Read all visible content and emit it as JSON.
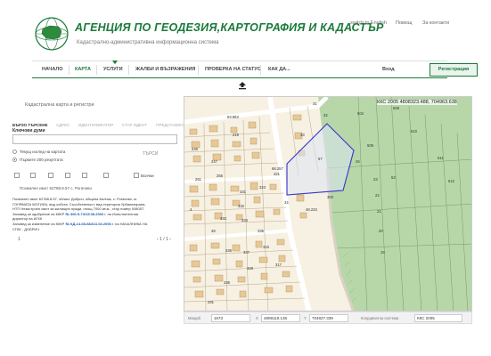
{
  "header": {
    "title": "АГЕНЦИЯ ПО ГЕОДЕЗИЯ,КАРТОГРАФИЯ И КАДАСТЪР",
    "subtitle": "Кадастрално-административна информационна система",
    "links": {
      "english": "switch to English",
      "help": "Помощ",
      "contacts": "За контакти"
    }
  },
  "nav": {
    "items": [
      "НАЧАЛО",
      "КАРТА",
      "УСЛУГИ",
      "ЖАЛБИ И ВЪЗРАЖЕНИЯ",
      "ПРОВЕРКА НА СТАТУС",
      "КАК ДА..."
    ],
    "active": "КАРТА",
    "login": "Вход",
    "register": "Регистрация"
  },
  "panel": {
    "title": "Кадастрална карта и регистри",
    "tabs": [
      "БЪРЗО ТЪРСЕНЕ",
      "АДРЕС",
      "ИДЕНТИФИКАТОР",
      "СТАР ИДЕНТ.",
      "ПРЕДСТАВЯНЕ"
    ],
    "keywords_label": "Ключови думи",
    "keywords_value": "",
    "radio_current_view": "Текущ изглед на картата",
    "radio_first_200": "Първите 200 резултата",
    "search_label": "ТЪРСИ",
    "all_label": "Всички",
    "result_count": "Поземлен имот 62788.8.57 с. Рогачево",
    "desc_line1": "Поземлен имот 62788.8.57, област Добрич, община Балчик, с. Рогачево, м.",
    "desc_line2": "ГОЛЯМАТА МОГИЛА, вид собств. Съсобственост, вид територия Урбанизирана,",
    "desc_line3": "НТП Незастроен имот за жилищни нужди, площ 7000 кв.м., стар номер 008057,",
    "desc_line4_prefix": "Заповед за одобрение на КККР",
    "desc_line4_link": "№ 300-5-73/15.08.2003",
    "desc_line4_suffix": "г. на Изпълнителния",
    "desc_line5": "директор на АГКК",
    "desc_line6_prefix": "Заповед за изменение на КККР",
    "desc_line6_link": "№ КД-14-08-684/11.04.2006",
    "desc_line6_suffix": "г. на НАЧАЛНИКА НА",
    "desc_line7": "СГКК - ДОБРИЧ",
    "pager_prev": "1",
    "pager": "‹ 1 / 1 ›"
  },
  "map": {
    "coords": "ККС 2005 4808323.488, 704963.638",
    "parcel_labels": [
      "31",
      "32",
      "33",
      "34",
      "504",
      "508",
      "509",
      "510",
      "511",
      "512",
      "53",
      "57",
      "26",
      "23",
      "22",
      "21",
      "20",
      "19",
      "321",
      "323",
      "331",
      "332",
      "333",
      "334",
      "335",
      "336",
      "337",
      "315",
      "317",
      "328",
      "336",
      "300",
      "291",
      "261",
      "255",
      "247",
      "246",
      "219",
      "4",
      "48",
      "68.257",
      "48.233",
      "63.963"
    ],
    "colors": {
      "parcel_fill": "#9cc38e",
      "building": "#e7c793",
      "selection": "#3333cc",
      "road": "#ffffff"
    }
  },
  "statusbar": {
    "scale_label": "Мащаб",
    "scale_value": "1673",
    "x_label": "X",
    "x_value": "4808119.136",
    "y_label": "Y",
    "y_value": "704827.339",
    "crs_label": "Координатна система",
    "crs_value": "ККС 2005"
  }
}
